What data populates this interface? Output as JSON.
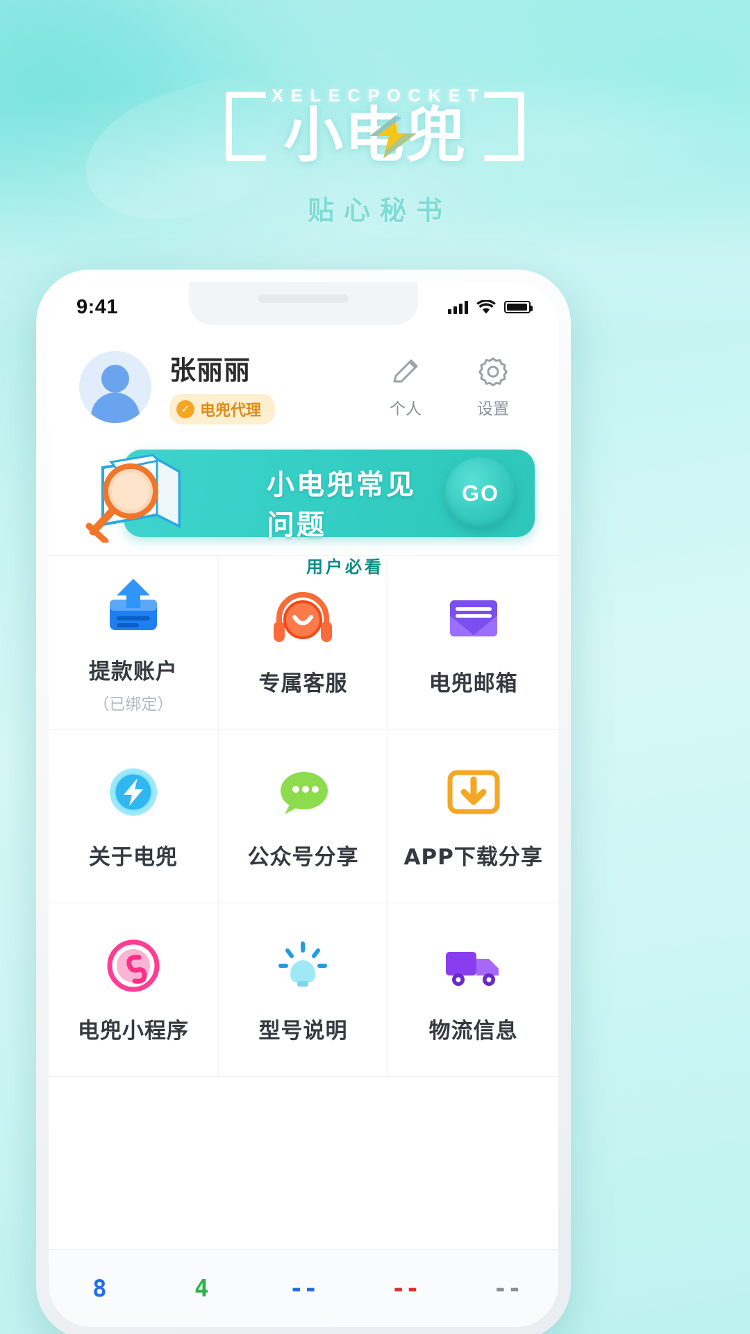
{
  "brand": {
    "english": "XELECPOCKET",
    "chinese": "小电兜",
    "tagline": "贴心秘书",
    "bolt_icon": "lightning-bolt-icon",
    "accent": "#3fd4cd",
    "bg_top": "#a5ece9",
    "bg_bottom": "#bdf2f0",
    "bolt_color": "#f5c518"
  },
  "status_bar": {
    "time": "9:41",
    "signal_icon": "cellular-signal-icon",
    "wifi_icon": "wifi-icon",
    "battery_icon": "battery-full-icon"
  },
  "profile": {
    "avatar_icon": "user-avatar-icon",
    "name": "张丽丽",
    "badge": {
      "icon": "verified-check-icon",
      "label": "电兜代理",
      "color": "#e08b1a",
      "bg": "#fdefcf"
    },
    "actions": [
      {
        "icon": "pencil-edit-icon",
        "label": "个人"
      },
      {
        "icon": "gear-settings-icon",
        "label": "设置"
      }
    ]
  },
  "banner": {
    "title": "小电兜常见问题",
    "subtitle": "用户必看",
    "cta": "GO",
    "art_icon": "magnifier-book-icon",
    "bg_color": "#36cfc6"
  },
  "grid": [
    {
      "icon": "withdraw-account-icon",
      "label": "提款账户",
      "sub": "（已绑定）",
      "color": "#1f7ff0"
    },
    {
      "icon": "headset-support-icon",
      "label": "专属客服",
      "sub": "",
      "color": "#fb6a3a"
    },
    {
      "icon": "mail-envelope-icon",
      "label": "电兜邮箱",
      "sub": "",
      "color": "#7b4ef0"
    },
    {
      "icon": "about-bolt-icon",
      "label": "关于电兜",
      "sub": "",
      "color": "#35c8f5"
    },
    {
      "icon": "wechat-chat-icon",
      "label": "公众号分享",
      "sub": "",
      "color": "#7ed321"
    },
    {
      "icon": "app-download-icon",
      "label": "APP下载分享",
      "sub": "",
      "color": "#f5a623"
    },
    {
      "icon": "mini-program-icon",
      "label": "电兜小程序",
      "sub": "",
      "color": "#ff3d92"
    },
    {
      "icon": "lightbulb-model-icon",
      "label": "型号说明",
      "sub": "",
      "color": "#4fd2f2"
    },
    {
      "icon": "delivery-truck-icon",
      "label": "物流信息",
      "sub": "",
      "color": "#8a3df0"
    }
  ],
  "tabbar": [
    {
      "label": "8",
      "color": "#1f6fe8"
    },
    {
      "label": "4",
      "color": "#2bb24c"
    },
    {
      "label": "--",
      "color": "#1f6fe8"
    },
    {
      "label": "--",
      "color": "#e03030"
    },
    {
      "label": "--",
      "color": "#8a8f96"
    }
  ]
}
